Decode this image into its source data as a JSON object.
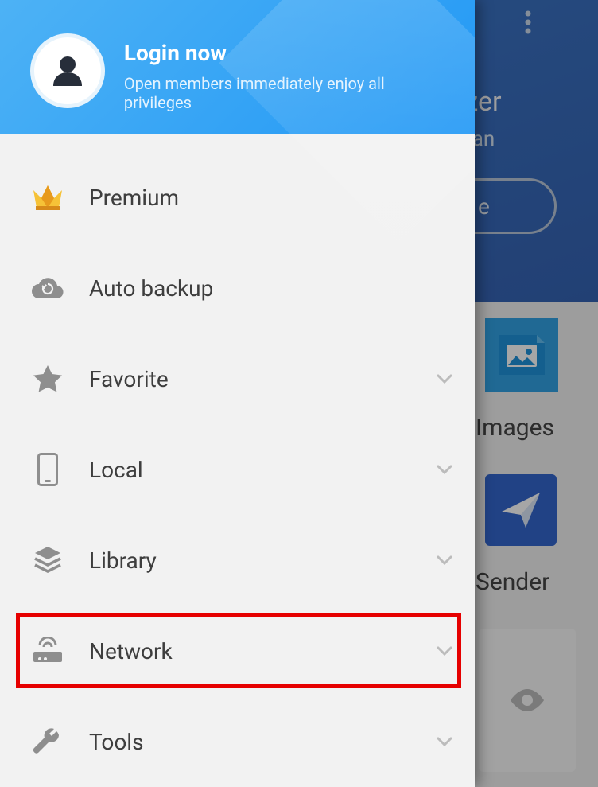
{
  "background": {
    "title_tail": "lyzer",
    "subtitle_tail": "clean",
    "button_tail": "e",
    "card1_label": "Images",
    "card2_label": "Sender"
  },
  "drawer": {
    "login": {
      "title": "Login now",
      "subtitle": "Open members immediately enjoy all privileges"
    },
    "items": [
      {
        "label": "Premium",
        "chevron": false
      },
      {
        "label": "Auto backup",
        "chevron": false
      },
      {
        "label": "Favorite",
        "chevron": true
      },
      {
        "label": "Local",
        "chevron": true
      },
      {
        "label": "Library",
        "chevron": true
      },
      {
        "label": "Network",
        "chevron": true
      },
      {
        "label": "Tools",
        "chevron": true
      }
    ]
  }
}
